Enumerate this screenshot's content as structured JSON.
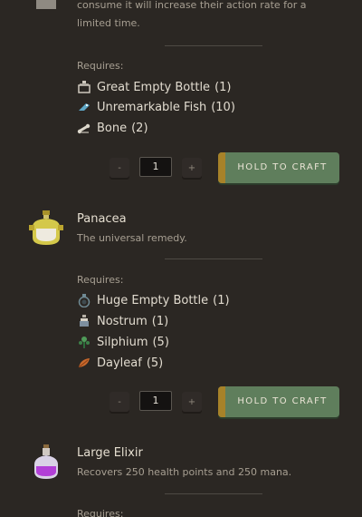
{
  "recipes": [
    {
      "name": "",
      "description_line1": "consume it will increase their action rate for a",
      "description_line2": "limited time.",
      "requires_label": "Requires:",
      "ingredients": [
        {
          "icon": "great-empty-bottle-icon",
          "name": "Great Empty Bottle",
          "count": "(1)"
        },
        {
          "icon": "unremarkable-fish-icon",
          "name": "Unremarkable Fish",
          "count": "(10)"
        },
        {
          "icon": "bone-icon",
          "name": "Bone",
          "count": "(2)"
        }
      ],
      "quantity": "1",
      "minus_label": "-",
      "plus_label": "+",
      "craft_label": "HOLD TO CRAFT"
    },
    {
      "name": "Panacea",
      "description": "The universal remedy.",
      "icon": "panacea-icon",
      "requires_label": "Requires:",
      "ingredients": [
        {
          "icon": "huge-empty-bottle-icon",
          "name": "Huge Empty Bottle",
          "count": "(1)"
        },
        {
          "icon": "nostrum-icon",
          "name": "Nostrum",
          "count": "(1)"
        },
        {
          "icon": "silphium-icon",
          "name": "Silphium",
          "count": "(5)"
        },
        {
          "icon": "dayleaf-icon",
          "name": "Dayleaf",
          "count": "(5)"
        }
      ],
      "quantity": "1",
      "minus_label": "-",
      "plus_label": "+",
      "craft_label": "HOLD TO CRAFT"
    },
    {
      "name": "Large Elixir",
      "description": "Recovers 250 health points and 250 mana.",
      "icon": "large-elixir-icon",
      "requires_label": "Requires:"
    }
  ],
  "colors": {
    "background": "#2b2723",
    "craft_button": "#5f7e5c",
    "craft_button_edge": "#a78229"
  }
}
